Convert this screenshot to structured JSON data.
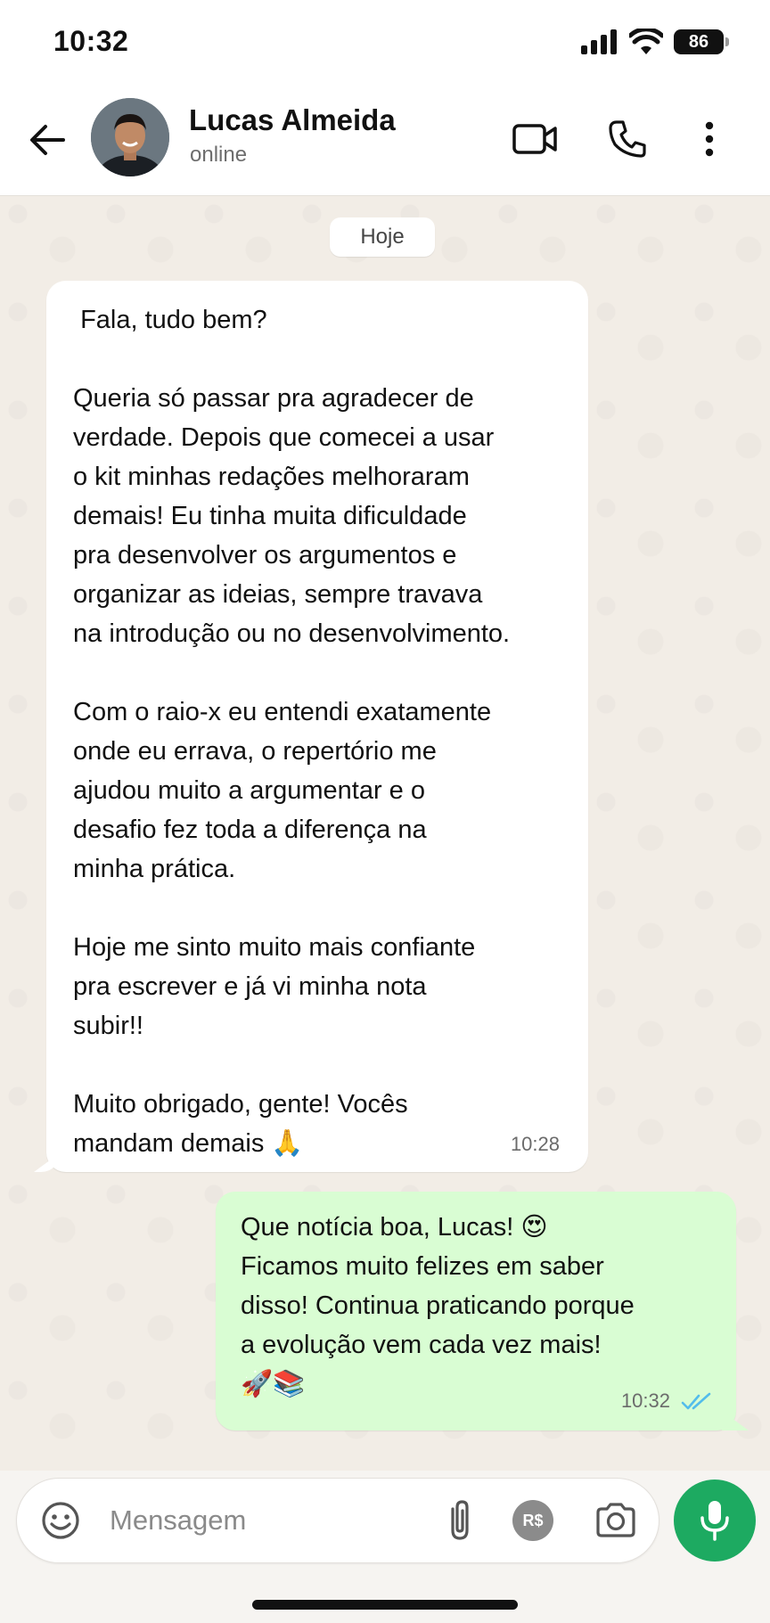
{
  "status_bar": {
    "time": "10:32",
    "battery": "86"
  },
  "header": {
    "contact_name": "Lucas Almeida",
    "contact_status": "online"
  },
  "chat": {
    "date_chip": "Hoje",
    "incoming_message": {
      "text": " Fala, tudo bem?\n\nQueria só passar pra agradecer de\nverdade. Depois que comecei a usar\no kit minhas redações melhoraram\ndemais! Eu tinha muita dificuldade\npra desenvolver os argumentos e\norganizar as ideias, sempre travava\nna introdução ou no desenvolvimento.\n\nCom o raio-x eu entendi exatamente\nonde eu errava, o repertório me\najudou muito a argumentar e o\ndesafio fez toda a diferença na\nminha prática.\n\nHoje me sinto muito mais confiante\npra escrever e já vi minha nota\nsubir!!\n\nMuito obrigado, gente! Vocês\nmandam demais 🙏",
      "time": "10:28"
    },
    "outgoing_message": {
      "text": "Que notícia boa, Lucas! 😍\nFicamos muito felizes em saber\ndisso! Continua praticando porque\na evolução vem cada vez mais!\n🚀📚",
      "time": "10:32",
      "read_status": "read"
    }
  },
  "composer": {
    "placeholder": "Mensagem",
    "pay_label": "R$"
  },
  "colors": {
    "accent_green": "#1daa61",
    "outgoing_bubble": "#d9fdd3",
    "read_ticks": "#53bdeb"
  }
}
